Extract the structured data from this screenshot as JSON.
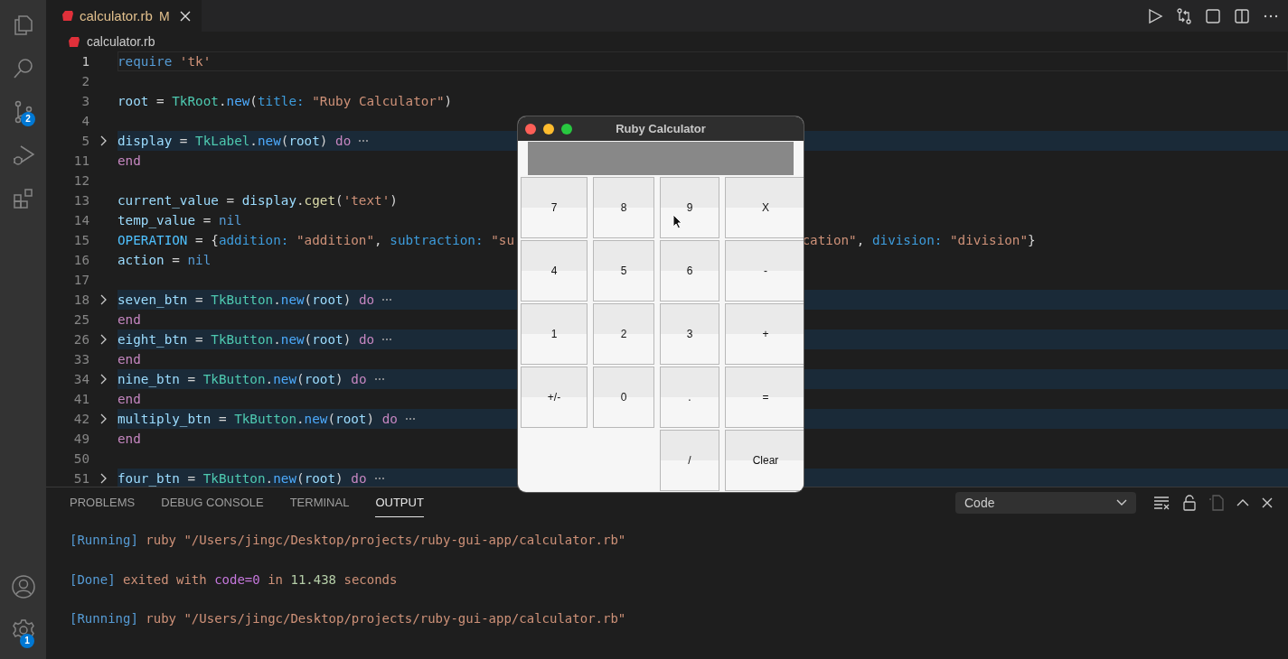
{
  "activity_bar": {
    "top": [
      {
        "selected": false
      },
      {
        "selected": false
      },
      {
        "selected": false,
        "badge": "2"
      },
      {
        "selected": false
      },
      {
        "selected": false
      }
    ],
    "settings_badge": "1"
  },
  "tabs": [
    {
      "label": "calculator.rb",
      "status": "M",
      "selected": true
    }
  ],
  "breadcrumb": "calculator.rb",
  "code_lines": [
    {
      "number": "1",
      "current": true,
      "folded": false,
      "tokens": [
        {
          "text": "require",
          "kind": "keyword"
        },
        {
          "text": " 'tk'",
          "kind": "string"
        }
      ]
    },
    {
      "number": "2",
      "current": false,
      "folded": false
    },
    {
      "number": "3",
      "current": false,
      "folded": false,
      "tokens": [
        {
          "text": "root",
          "kind": "variable"
        },
        {
          "text": " = ",
          "kind": "plain"
        },
        {
          "text": "TkRoot",
          "kind": "class"
        },
        {
          "text": ".",
          "kind": "plain"
        },
        {
          "text": "new",
          "kind": "method"
        },
        {
          "text": "(",
          "kind": "plain"
        },
        {
          "text": "title:",
          "kind": "symbol"
        },
        {
          "text": " \"Ruby Calculator\"",
          "kind": "string"
        },
        {
          "text": ")",
          "kind": "plain"
        }
      ]
    },
    {
      "number": "4",
      "current": false,
      "folded": false
    },
    {
      "number": "5",
      "current": false,
      "folded": true,
      "tokens": [
        {
          "text": "display",
          "kind": "variable"
        },
        {
          "text": " = ",
          "kind": "plain"
        },
        {
          "text": "TkLabel",
          "kind": "class"
        },
        {
          "text": ".",
          "kind": "plain"
        },
        {
          "text": "new",
          "kind": "method"
        },
        {
          "text": "(",
          "kind": "plain"
        },
        {
          "text": "root",
          "kind": "variable"
        },
        {
          "text": ") ",
          "kind": "plain"
        },
        {
          "text": "do",
          "kind": "control"
        }
      ]
    },
    {
      "number": "11",
      "current": false,
      "folded": false,
      "tokens": [
        {
          "text": "end",
          "kind": "control"
        }
      ]
    },
    {
      "number": "12",
      "current": false,
      "folded": false
    },
    {
      "number": "13",
      "current": false,
      "folded": false,
      "tokens": [
        {
          "text": "current_value",
          "kind": "variable"
        },
        {
          "text": " = ",
          "kind": "plain"
        },
        {
          "text": "display",
          "kind": "variable"
        },
        {
          "text": ".",
          "kind": "plain"
        },
        {
          "text": "cget",
          "kind": "call"
        },
        {
          "text": "(",
          "kind": "plain"
        },
        {
          "text": "'text'",
          "kind": "string"
        },
        {
          "text": ")",
          "kind": "plain"
        }
      ]
    },
    {
      "number": "14",
      "current": false,
      "folded": false,
      "tokens": [
        {
          "text": "temp_value",
          "kind": "variable"
        },
        {
          "text": " = ",
          "kind": "plain"
        },
        {
          "text": "nil",
          "kind": "keyword"
        }
      ]
    },
    {
      "number": "15",
      "current": false,
      "folded": false,
      "tokens": [
        {
          "text": "OPERATION",
          "kind": "constant"
        },
        {
          "text": " = {",
          "kind": "plain"
        },
        {
          "text": "addition:",
          "kind": "symbol"
        },
        {
          "text": " \"addition\"",
          "kind": "string"
        },
        {
          "text": ", ",
          "kind": "plain"
        },
        {
          "text": "subtraction:",
          "kind": "symbol"
        },
        {
          "text": " \"su",
          "kind": "string"
        }
      ],
      "tail_tokens": [
        {
          "text": "cation\"",
          "kind": "string"
        },
        {
          "text": ", ",
          "kind": "plain"
        },
        {
          "text": "division:",
          "kind": "symbol"
        },
        {
          "text": " \"division\"",
          "kind": "string"
        },
        {
          "text": "}",
          "kind": "plain"
        }
      ]
    },
    {
      "number": "16",
      "current": false,
      "folded": false,
      "tokens": [
        {
          "text": "action",
          "kind": "variable"
        },
        {
          "text": " = ",
          "kind": "plain"
        },
        {
          "text": "nil",
          "kind": "keyword"
        }
      ]
    },
    {
      "number": "17",
      "current": false,
      "folded": false
    },
    {
      "number": "18",
      "current": false,
      "folded": true,
      "tokens": [
        {
          "text": "seven_btn",
          "kind": "variable"
        },
        {
          "text": " = ",
          "kind": "plain"
        },
        {
          "text": "TkButton",
          "kind": "class"
        },
        {
          "text": ".",
          "kind": "plain"
        },
        {
          "text": "new",
          "kind": "method"
        },
        {
          "text": "(",
          "kind": "plain"
        },
        {
          "text": "root",
          "kind": "variable"
        },
        {
          "text": ") ",
          "kind": "plain"
        },
        {
          "text": "do",
          "kind": "control"
        }
      ]
    },
    {
      "number": "25",
      "current": false,
      "folded": false,
      "tokens": [
        {
          "text": "end",
          "kind": "control"
        }
      ]
    },
    {
      "number": "26",
      "current": false,
      "folded": true,
      "tokens": [
        {
          "text": "eight_btn",
          "kind": "variable"
        },
        {
          "text": " = ",
          "kind": "plain"
        },
        {
          "text": "TkButton",
          "kind": "class"
        },
        {
          "text": ".",
          "kind": "plain"
        },
        {
          "text": "new",
          "kind": "method"
        },
        {
          "text": "(",
          "kind": "plain"
        },
        {
          "text": "root",
          "kind": "variable"
        },
        {
          "text": ") ",
          "kind": "plain"
        },
        {
          "text": "do",
          "kind": "control"
        }
      ]
    },
    {
      "number": "33",
      "current": false,
      "folded": false,
      "tokens": [
        {
          "text": "end",
          "kind": "control"
        }
      ]
    },
    {
      "number": "34",
      "current": false,
      "folded": true,
      "tokens": [
        {
          "text": "nine_btn",
          "kind": "variable"
        },
        {
          "text": " = ",
          "kind": "plain"
        },
        {
          "text": "TkButton",
          "kind": "class"
        },
        {
          "text": ".",
          "kind": "plain"
        },
        {
          "text": "new",
          "kind": "method"
        },
        {
          "text": "(",
          "kind": "plain"
        },
        {
          "text": "root",
          "kind": "variable"
        },
        {
          "text": ") ",
          "kind": "plain"
        },
        {
          "text": "do",
          "kind": "control"
        }
      ]
    },
    {
      "number": "41",
      "current": false,
      "folded": false,
      "tokens": [
        {
          "text": "end",
          "kind": "control"
        }
      ]
    },
    {
      "number": "42",
      "current": false,
      "folded": true,
      "tokens": [
        {
          "text": "multiply_btn",
          "kind": "variable"
        },
        {
          "text": " = ",
          "kind": "plain"
        },
        {
          "text": "TkButton",
          "kind": "class"
        },
        {
          "text": ".",
          "kind": "plain"
        },
        {
          "text": "new",
          "kind": "method"
        },
        {
          "text": "(",
          "kind": "plain"
        },
        {
          "text": "root",
          "kind": "variable"
        },
        {
          "text": ") ",
          "kind": "plain"
        },
        {
          "text": "do",
          "kind": "control"
        }
      ]
    },
    {
      "number": "49",
      "current": false,
      "folded": false,
      "tokens": [
        {
          "text": "end",
          "kind": "control"
        }
      ]
    },
    {
      "number": "50",
      "current": false,
      "folded": false
    },
    {
      "number": "51",
      "current": false,
      "folded": true,
      "tokens": [
        {
          "text": "four_btn",
          "kind": "variable"
        },
        {
          "text": " = ",
          "kind": "plain"
        },
        {
          "text": "TkButton",
          "kind": "class"
        },
        {
          "text": ".",
          "kind": "plain"
        },
        {
          "text": "new",
          "kind": "method"
        },
        {
          "text": "(",
          "kind": "plain"
        },
        {
          "text": "root",
          "kind": "variable"
        },
        {
          "text": ") ",
          "kind": "plain"
        },
        {
          "text": "do",
          "kind": "control"
        }
      ]
    }
  ],
  "panel": {
    "tabs": [
      {
        "label": "PROBLEMS",
        "selected": false
      },
      {
        "label": "DEBUG CONSOLE",
        "selected": false
      },
      {
        "label": "TERMINAL",
        "selected": false
      },
      {
        "label": "OUTPUT",
        "selected": true
      }
    ],
    "channel_select": {
      "value": "Code"
    },
    "actions": [
      {
        "disabled": false
      },
      {
        "disabled": false
      },
      {
        "disabled": true
      },
      {
        "disabled": false
      },
      {
        "disabled": false
      }
    ],
    "output_lines": [
      [
        {
          "text": "[Running]",
          "kind": "tag"
        },
        {
          "text": " ruby \"/Users/jingc/Desktop/projects/ruby-gui-app/calculator.rb\"",
          "kind": "text"
        }
      ],
      [
        {
          "text": "[Done]",
          "kind": "tag"
        },
        {
          "text": " exited with ",
          "kind": "text"
        },
        {
          "text": "code=0",
          "kind": "code"
        },
        {
          "text": " in ",
          "kind": "text"
        },
        {
          "text": "11.438",
          "kind": "number"
        },
        {
          "text": " seconds",
          "kind": "text"
        }
      ],
      [
        {
          "text": "[Running]",
          "kind": "tag"
        },
        {
          "text": " ruby \"/Users/jingc/Desktop/projects/ruby-gui-app/calculator.rb\"",
          "kind": "text"
        }
      ]
    ]
  },
  "calculator_window": {
    "title": "Ruby Calculator",
    "rows": [
      [
        "7",
        "8",
        "9",
        "X"
      ],
      [
        "4",
        "5",
        "6",
        "-"
      ],
      [
        "1",
        "2",
        "3",
        "+"
      ],
      [
        "+/-",
        "0",
        ".",
        "="
      ],
      [
        "",
        "",
        "/",
        "Clear"
      ]
    ]
  }
}
